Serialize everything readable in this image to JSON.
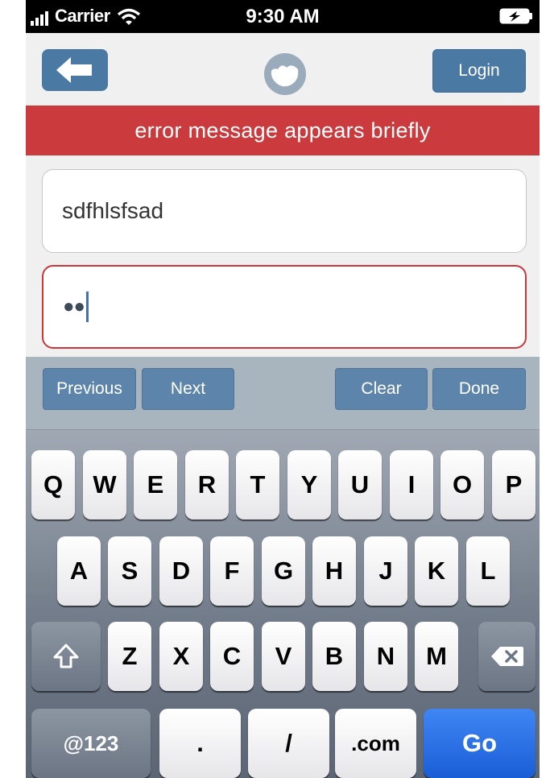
{
  "status_bar": {
    "carrier": "Carrier",
    "time": "9:30 AM"
  },
  "nav": {
    "login_label": "Login",
    "back_icon": "left-arrow-icon",
    "logo_icon": "logo-icon"
  },
  "error_banner": {
    "text": "error message appears briefly",
    "color": "#cb3b3d"
  },
  "form": {
    "username_value": "sdfhlsfsad",
    "password_masked": "●●"
  },
  "accessory": {
    "previous": "Previous",
    "next": "Next",
    "clear": "Clear",
    "done": "Done"
  },
  "keyboard": {
    "row1": [
      "Q",
      "W",
      "E",
      "R",
      "T",
      "Y",
      "U",
      "I",
      "O",
      "P"
    ],
    "row2": [
      "A",
      "S",
      "D",
      "F",
      "G",
      "H",
      "J",
      "K",
      "L"
    ],
    "row3": [
      "Z",
      "X",
      "C",
      "V",
      "B",
      "N",
      "M"
    ],
    "bottom": {
      "numbers": "@123",
      "dot": ".",
      "slash": "/",
      "com": ".com",
      "go": "Go"
    }
  },
  "colors": {
    "accent": "#4a7aa4",
    "go": "#2a6fe6"
  }
}
